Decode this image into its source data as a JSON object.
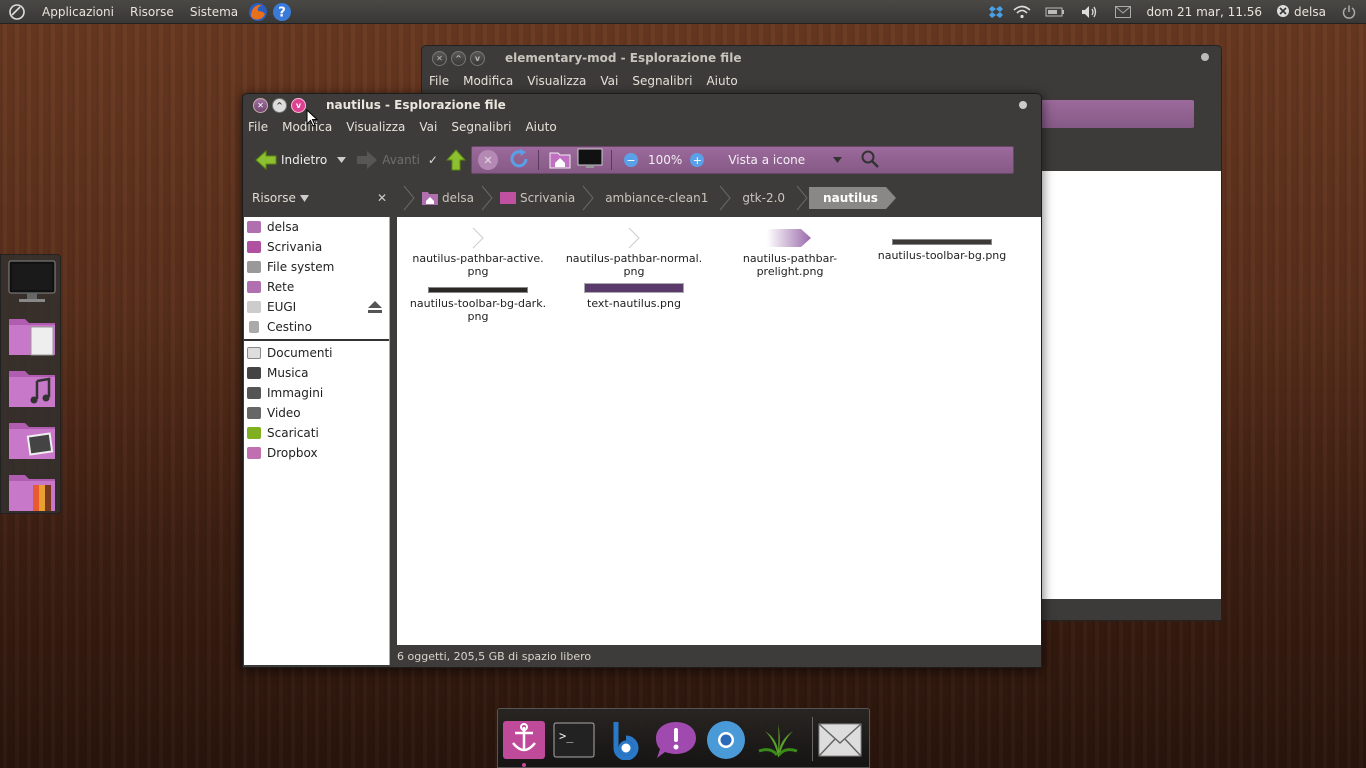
{
  "top_panel": {
    "menu": [
      "Applicazioni",
      "Risorse",
      "Sistema"
    ],
    "clock": "dom 21 mar, 11.56",
    "user": "delsa"
  },
  "back_window": {
    "title": "elementary-mod - Esplorazione file",
    "menu": [
      "File",
      "Modifica",
      "Visualizza",
      "Vai",
      "Segnalibri",
      "Aiuto"
    ]
  },
  "front_window": {
    "title": "nautilus - Esplorazione file",
    "menu": [
      "File",
      "Modifica",
      "Visualizza",
      "Vai",
      "Segnalibri",
      "Aiuto"
    ],
    "toolbar": {
      "back": "Indietro",
      "forward": "Avanti",
      "zoom": "100%",
      "view": "Vista a icone"
    },
    "sidebar_header": "Risorse",
    "path": [
      "delsa",
      "Scrivania",
      "ambiance-clean1",
      "gtk-2.0",
      "nautilus"
    ],
    "sidebar_places": [
      {
        "label": "delsa",
        "color": "#b070b0"
      },
      {
        "label": "Scrivania",
        "color": "#b050a0"
      },
      {
        "label": "File system",
        "color": "#999999"
      },
      {
        "label": "Rete",
        "color": "#b070b0"
      },
      {
        "label": "EUGI",
        "color": "#cccccc"
      },
      {
        "label": "Cestino",
        "color": "#aaaaaa"
      }
    ],
    "sidebar_bookmarks": [
      {
        "label": "Documenti",
        "color": "#dddddd"
      },
      {
        "label": "Musica",
        "color": "#444444"
      },
      {
        "label": "Immagini",
        "color": "#555555"
      },
      {
        "label": "Video",
        "color": "#666666"
      },
      {
        "label": "Scaricati",
        "color": "#80b020"
      },
      {
        "label": "Dropbox",
        "color": "#c070b0"
      }
    ],
    "files": [
      {
        "name1": "nautilus-pathbar-active.",
        "name2": "png"
      },
      {
        "name1": "nautilus-pathbar-normal.",
        "name2": "png"
      },
      {
        "name1": "nautilus-pathbar-",
        "name2": "prelight.png"
      },
      {
        "name1": "nautilus-toolbar-bg.png",
        "name2": ""
      },
      {
        "name1": "nautilus-toolbar-bg-dark.",
        "name2": "png"
      },
      {
        "name1": "text-nautilus.png",
        "name2": ""
      }
    ],
    "status": "6 oggetti, 205,5 GB di spazio libero"
  },
  "colors": {
    "accent": "#8e5e8e",
    "panel": "#3c3b37"
  }
}
